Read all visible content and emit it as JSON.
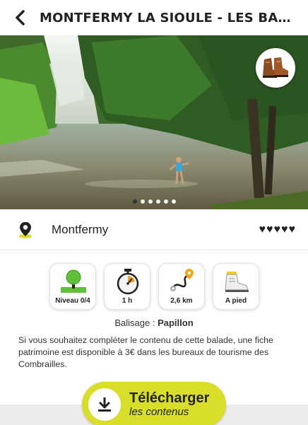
{
  "header": {
    "title": "MONTFERMY LA SIOULE - LES BALADES DE LA SIOULE",
    "back_icon": "chevron-left-icon"
  },
  "hero": {
    "image": "waterfall-river-photo",
    "mode_icon": "hiking-boots-icon",
    "carousel": {
      "count": 6,
      "active_index": 0
    }
  },
  "place": {
    "icon": "map-pin-icon",
    "name": "Montfermy",
    "hearts": 5,
    "heart_glyph": "♥"
  },
  "stats": [
    {
      "icon": "tree-icon",
      "label": "Niveau 0/4"
    },
    {
      "icon": "stopwatch-icon",
      "label": "1 h"
    },
    {
      "icon": "route-distance-icon",
      "label": "2,6 km"
    },
    {
      "icon": "walking-shoe-icon",
      "label": "A pied"
    }
  ],
  "balisage": {
    "label": "Balisage :",
    "value": "Papillon"
  },
  "description": "Si vous souhaitez compléter le contenu de cette balade, une fiche patrimoine est disponible à 3€ dans les bureaux de tourisme des Combrailles.",
  "download": {
    "icon": "download-icon",
    "main": "Télécharger",
    "sub": "les contenus",
    "color": "#d9de2a"
  }
}
